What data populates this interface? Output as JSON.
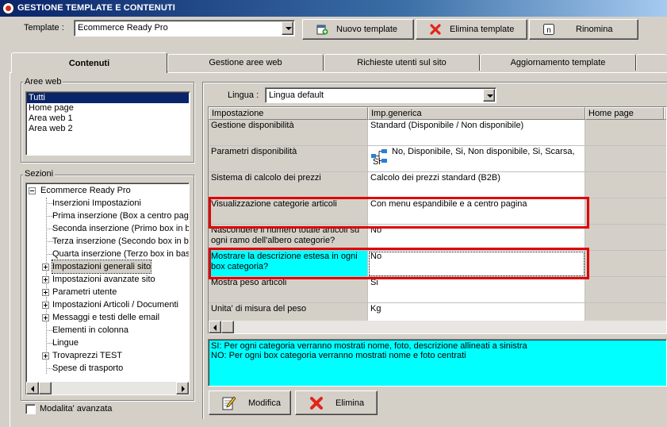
{
  "window": {
    "title": "GESTIONE TEMPLATE E CONTENUTI"
  },
  "toolbar": {
    "template_label": "Template :",
    "template_value": "Ecommerce Ready Pro",
    "new_template": "Nuovo template",
    "delete_template": "Elimina template",
    "rename": "Rinomina"
  },
  "tabs": [
    {
      "label": "Contenuti",
      "active": true
    },
    {
      "label": "Gestione aree web"
    },
    {
      "label": "Richieste utenti sul sito"
    },
    {
      "label": "Aggiornamento template"
    }
  ],
  "aree_web": {
    "label": "Aree web",
    "items": [
      "Tutti",
      "Home page",
      "Area web 1",
      "Area web 2"
    ],
    "selected": 0
  },
  "sezioni": {
    "label": "Sezioni",
    "root": "Ecommerce Ready Pro",
    "children": [
      {
        "label": "Inserzioni Impostazioni",
        "expandable": false
      },
      {
        "label": "Prima inserzione (Box a centro pagin",
        "expandable": false
      },
      {
        "label": "Seconda inserzione (Primo box in ba",
        "expandable": false
      },
      {
        "label": "Terza inserzione (Secondo box in ba",
        "expandable": false
      },
      {
        "label": "Quarta inserzione (Terzo box in bass",
        "expandable": false
      },
      {
        "label": "Impostazioni generali sito",
        "expandable": true,
        "selected": true
      },
      {
        "label": "Impostazioni avanzate sito",
        "expandable": true
      },
      {
        "label": "Parametri utente",
        "expandable": true
      },
      {
        "label": "Impostazioni Articoli / Documenti",
        "expandable": true
      },
      {
        "label": "Messaggi e testi delle email",
        "expandable": true
      },
      {
        "label": "Elementi in colonna",
        "expandable": false
      },
      {
        "label": "Lingue",
        "expandable": false
      },
      {
        "label": "Trovaprezzi TEST",
        "expandable": true
      },
      {
        "label": "Spese di trasporto",
        "expandable": false
      }
    ]
  },
  "modalita_avanzata": {
    "label": "Modalita' avanzata",
    "checked": false
  },
  "lingua": {
    "label": "Lingua :",
    "value": "Lingua default"
  },
  "grid": {
    "headers": [
      "Impostazione",
      "Imp.generica",
      "Home page"
    ],
    "rows": [
      {
        "name": "Gestione disponibilità",
        "value": "Standard (Disponibile / Non disponibile)"
      },
      {
        "name": "Parametri disponibilità",
        "value": "No, Disponibile, Si, Non disponibile, Si, Scarsa, Si",
        "value_icon": "tree-structure-icon"
      },
      {
        "name": "Sistema di calcolo dei prezzi",
        "value": "Calcolo dei prezzi standard (B2B)"
      },
      {
        "name": "Visualizzazione categorie articoli",
        "value": "Con menu espandibile e a centro pagina"
      },
      {
        "name": "Nascondere il numero totale articoli su ogni ramo dell'albero categorie?",
        "value": "No"
      },
      {
        "name": "Mostrare la descrizione estesa in ogni box categoria?",
        "value": "No",
        "selected": true
      },
      {
        "name": "Mostra peso articoli",
        "value": "Si"
      },
      {
        "name": "Unita' di misura del peso",
        "value": "Kg"
      }
    ]
  },
  "description": {
    "line1": "SI: Per ogni categoria verranno mostrati nome, foto, descrizione allineati a sinistra",
    "line2": "NO: Per ogni box categoria verranno mostrati nome e foto centrati"
  },
  "actions": {
    "edit": "Modifica",
    "delete": "Elimina"
  },
  "colors": {
    "highlight": "#00ffff",
    "annotation": "#e00000",
    "selection": "#0a246a"
  }
}
